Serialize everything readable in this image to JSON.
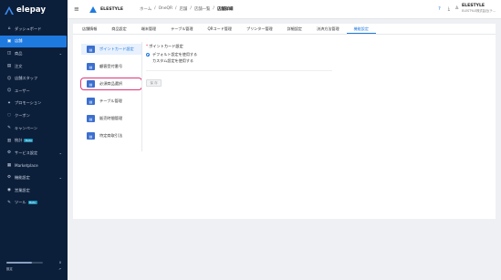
{
  "brand": {
    "name": "elepay",
    "accent": "#1f7ae0",
    "sidebar_bg": "#0c1f3a",
    "highlight": "#e0357a"
  },
  "sidebar": {
    "items": [
      {
        "label": "ダッシュボード",
        "icon": "dashboard-icon",
        "glyph": "⌂",
        "chevron": false,
        "active": false,
        "beta": ""
      },
      {
        "label": "店舗",
        "icon": "store-icon",
        "glyph": "▣",
        "chevron": false,
        "active": true,
        "beta": ""
      },
      {
        "label": "商品",
        "icon": "product-icon",
        "glyph": "◫",
        "chevron": true,
        "active": false,
        "beta": ""
      },
      {
        "label": "注文",
        "icon": "order-icon",
        "glyph": "▤",
        "chevron": false,
        "active": false,
        "beta": ""
      },
      {
        "label": "店舗スタッフ",
        "icon": "staff-icon",
        "glyph": "☺",
        "chevron": false,
        "active": false,
        "beta": ""
      },
      {
        "label": "ユーザー",
        "icon": "user-icon",
        "glyph": "☺",
        "chevron": false,
        "active": false,
        "beta": ""
      },
      {
        "label": "プロモーション",
        "icon": "promotion-icon",
        "glyph": "✦",
        "chevron": false,
        "active": false,
        "beta": ""
      },
      {
        "label": "クーポン",
        "icon": "coupon-icon",
        "glyph": "◌",
        "chevron": false,
        "active": false,
        "beta": ""
      },
      {
        "label": "キャンペーン",
        "icon": "campaign-icon",
        "glyph": "✎",
        "chevron": false,
        "active": false,
        "beta": ""
      },
      {
        "label": "統計",
        "icon": "stats-icon",
        "glyph": "▥",
        "chevron": false,
        "active": false,
        "beta": "Beta"
      },
      {
        "label": "サービス設定",
        "icon": "service-settings-icon",
        "glyph": "⚙",
        "chevron": true,
        "active": false,
        "beta": ""
      },
      {
        "label": "Marketplace",
        "icon": "marketplace-icon",
        "glyph": "▦",
        "chevron": false,
        "active": false,
        "beta": ""
      },
      {
        "label": "機能設定",
        "icon": "feature-settings-icon",
        "glyph": "⚙",
        "chevron": true,
        "active": false,
        "beta": ""
      },
      {
        "label": "営業設定",
        "icon": "business-settings-icon",
        "glyph": "◉",
        "chevron": false,
        "active": false,
        "beta": ""
      },
      {
        "label": "ツール",
        "icon": "tool-icon",
        "glyph": "✎",
        "chevron": false,
        "active": false,
        "beta": "Beta"
      }
    ],
    "footer": {
      "usage_label": "残量",
      "usage_value": "0",
      "usage_fraction": 0.7,
      "link_label": "設定",
      "link_glyph": "↗"
    }
  },
  "header": {
    "menu_glyph": "≡",
    "store_name": "ELESTYLE",
    "breadcrumb": [
      "ホーム",
      "/",
      "OneQR",
      "/",
      "店舗",
      "/",
      "店舗一覧",
      "/",
      "店舗詳細"
    ],
    "icons": [
      {
        "name": "help-icon",
        "glyph": "?"
      },
      {
        "name": "download-icon",
        "glyph": "⤓"
      }
    ],
    "user": {
      "name": "ELESTYLE",
      "org": "ELESTYLE株式会社(テ...",
      "glyph": "♙"
    }
  },
  "tabs": [
    {
      "label": "店舗情報",
      "active": false
    },
    {
      "label": "商品設定",
      "active": false
    },
    {
      "label": "端末管理",
      "active": false
    },
    {
      "label": "テーブル管理",
      "active": false
    },
    {
      "label": "QRコード管理",
      "active": false
    },
    {
      "label": "プリンター管理",
      "active": false
    },
    {
      "label": "詳細設定",
      "active": false
    },
    {
      "label": "決済方法管理",
      "active": false
    },
    {
      "label": "機能設定",
      "active": true
    }
  ],
  "feature_menu": [
    {
      "label": "ポイントカード設定",
      "active": true,
      "highlight": false
    },
    {
      "label": "顧客受付番号",
      "active": false,
      "highlight": false
    },
    {
      "label": "必須商品選択",
      "active": false,
      "highlight": true
    },
    {
      "label": "テーブル管理",
      "active": false,
      "highlight": false
    },
    {
      "label": "販売時間管理",
      "active": false,
      "highlight": false
    },
    {
      "label": "特定商取引法",
      "active": false,
      "highlight": false
    }
  ],
  "form": {
    "required_mark": "*",
    "label": "ポイントカード設定",
    "option_default": "デフォルト設定を使用する",
    "option_custom": "カスタム設定を使用する",
    "save_label": "保 存"
  }
}
